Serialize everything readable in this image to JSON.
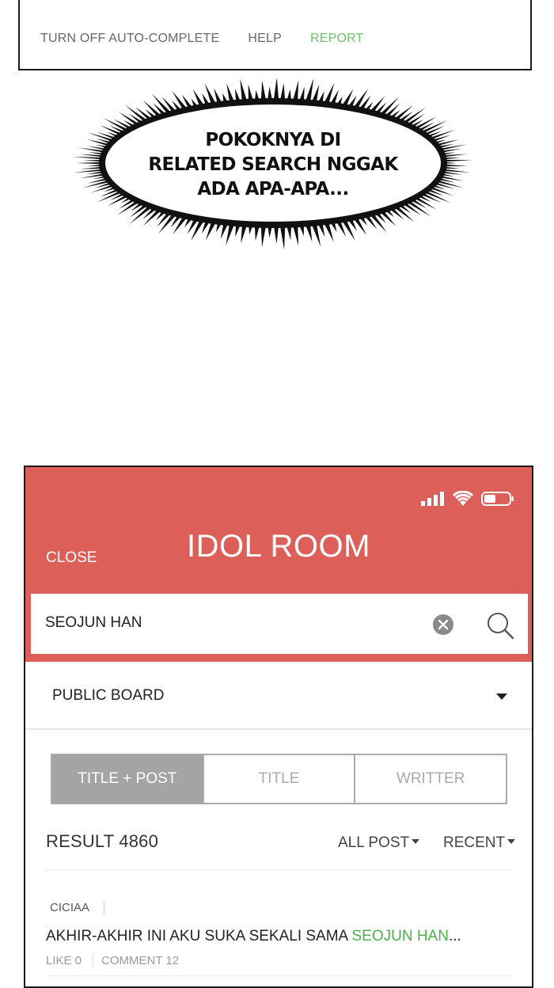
{
  "top_panel": {
    "links": {
      "autocomplete": "TURN OFF AUTO-COMPLETE",
      "help": "HELP",
      "report": "REPORT"
    }
  },
  "bubble": {
    "lines": [
      "POKOKNYA DI",
      "RELATED SEARCH NGGAK",
      "ADA APA-APA..."
    ]
  },
  "app": {
    "close_label": "CLOSE",
    "title": "IDOL ROOM",
    "search": {
      "value": "SEOJUN HAN"
    },
    "board": {
      "selected": "PUBLIC BOARD"
    },
    "tabs": [
      {
        "label": "TITLE + POST",
        "active": true
      },
      {
        "label": "TITLE",
        "active": false
      },
      {
        "label": "WRITTER",
        "active": false
      }
    ],
    "result_label": "RESULT 4860",
    "filters": {
      "scope": "ALL POST",
      "sort": "RECENT"
    },
    "post": {
      "author": "CICIAA",
      "title_prefix": "AKHIR-AKHIR INI AKU SUKA SEKALI SAMA ",
      "title_highlight": "SEOJUN HAN",
      "title_suffix": "...",
      "likes": "LIKE 0",
      "comments": "COMMENT 12"
    },
    "colors": {
      "header": "#dc6059",
      "highlight": "#4ab04a",
      "report": "#6cc26a"
    },
    "icons": [
      "signal-icon",
      "wifi-icon",
      "battery-icon",
      "clear-icon",
      "search-icon",
      "dropdown-icon"
    ]
  }
}
